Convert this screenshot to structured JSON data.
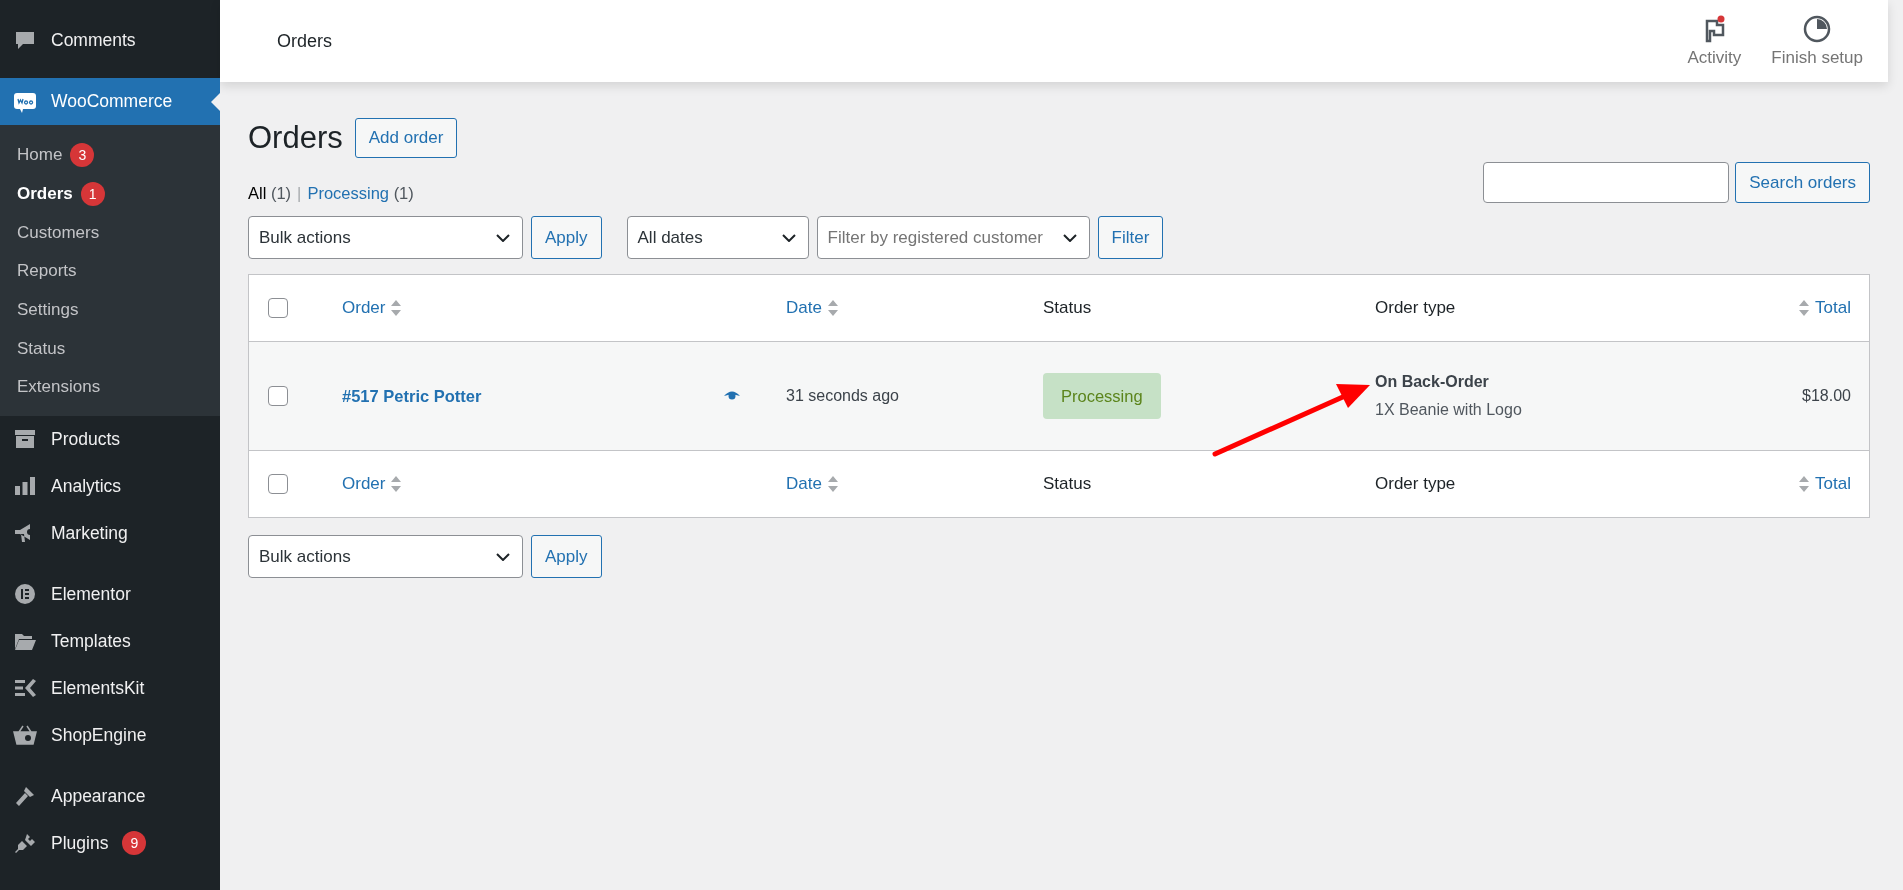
{
  "sidebar": {
    "sections": [
      {
        "items": [
          {
            "label": "Comments",
            "selected": false
          }
        ]
      },
      {
        "items": [
          {
            "label": "WooCommerce",
            "selected": true,
            "children": [
              {
                "label": "Home",
                "selected": false,
                "badge": "3"
              },
              {
                "label": "Orders",
                "selected": true,
                "badge": "1"
              },
              {
                "label": "Customers",
                "selected": false
              },
              {
                "label": "Reports",
                "selected": false
              },
              {
                "label": "Settings",
                "selected": false
              },
              {
                "label": "Status",
                "selected": false
              },
              {
                "label": "Extensions",
                "selected": false
              }
            ]
          },
          {
            "label": "Products",
            "selected": false
          },
          {
            "label": "Analytics",
            "selected": false
          },
          {
            "label": "Marketing",
            "selected": false
          }
        ]
      },
      {
        "items": [
          {
            "label": "Elementor",
            "selected": false
          },
          {
            "label": "Templates",
            "selected": false
          },
          {
            "label": "ElementsKit",
            "selected": false
          },
          {
            "label": "ShopEngine",
            "selected": false
          }
        ]
      },
      {
        "items": [
          {
            "label": "Appearance",
            "selected": false
          },
          {
            "label": "Plugins",
            "selected": false,
            "badge": "9"
          }
        ]
      }
    ]
  },
  "header": {
    "title": "Orders",
    "actions": [
      {
        "label": "Activity",
        "notification": true
      },
      {
        "label": "Finish setup",
        "notification": false
      }
    ]
  },
  "page": {
    "title": "Orders",
    "add_button": "Add order"
  },
  "views": [
    {
      "label": "All",
      "count": "(1)",
      "selected": true
    },
    {
      "label": "Processing",
      "count": "(1)",
      "selected": false
    }
  ],
  "view_separator": "|",
  "search": {
    "button": "Search orders"
  },
  "tablenav_top": {
    "bulk": "Bulk actions",
    "apply": "Apply",
    "date": "All dates",
    "customer_placeholder": "Filter by registered customer",
    "filter": "Filter"
  },
  "table": {
    "columns": [
      {
        "label": "Order",
        "sortable": true
      },
      {
        "label": "Date",
        "sortable": true
      },
      {
        "label": "Status",
        "sortable": false
      },
      {
        "label": "Order type",
        "sortable": false
      },
      {
        "label": "Total",
        "sortable": true
      }
    ],
    "footer_columns": [
      {
        "label": "Order",
        "sortable": true
      },
      {
        "label": "Date",
        "sortable": true
      },
      {
        "label": "Status",
        "sortable": false
      },
      {
        "label": "Order type",
        "sortable": false
      },
      {
        "label": "Total",
        "sortable": true
      }
    ],
    "header_checked": false,
    "footer_checked": false,
    "rows": [
      {
        "checked": false,
        "order": "#517 Petric Potter",
        "date": "31 seconds ago",
        "status": "Processing",
        "order_type": "On Back-Order",
        "items": "1X Beanie with Logo",
        "total": "$18.00"
      }
    ]
  },
  "tablenav_bottom": {
    "bulk": "Bulk actions",
    "apply": "Apply"
  },
  "annotation": {
    "kind": "arrow"
  }
}
